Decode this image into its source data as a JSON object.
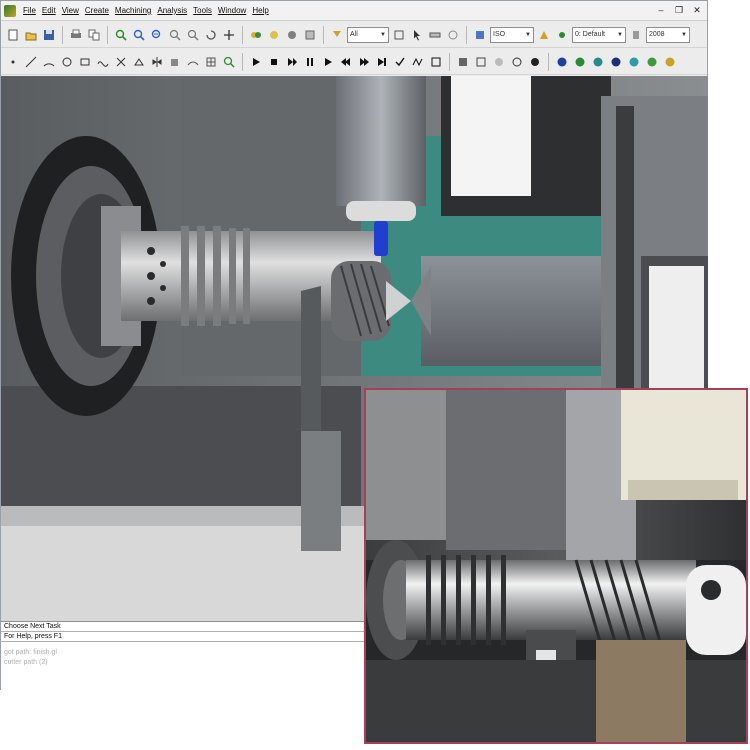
{
  "menu": {
    "items": [
      "File",
      "Edit",
      "View",
      "Create",
      "Machining",
      "Analysis",
      "Tools",
      "Window",
      "Help"
    ]
  },
  "window_controls": {
    "minimize": "–",
    "restore": "❐",
    "close": "✕"
  },
  "toolbar": {
    "select_all": "All",
    "select_iso": "ISO",
    "select_default": "0: Default",
    "select_zoom": "2008"
  },
  "status": {
    "prompt": "Choose Next Task",
    "help": "For Help, press F1",
    "log_1": "got path: finish.gl",
    "log_2": "cutter path (2)"
  },
  "colors": {
    "accent_border": "#a2415a",
    "tool_blue": "#1f3fd0",
    "teal_panel": "#3d8a80"
  }
}
